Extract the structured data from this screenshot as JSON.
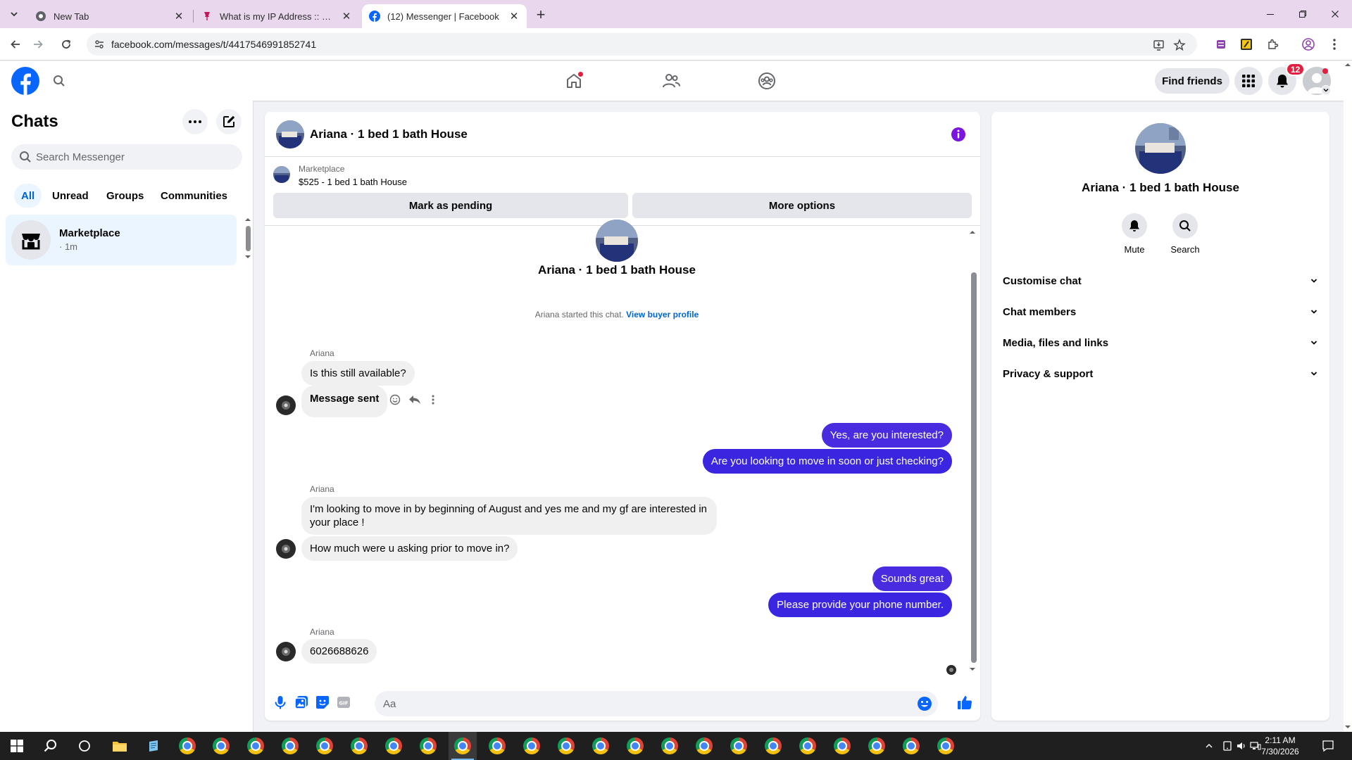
{
  "browser": {
    "tabs": [
      {
        "title": "New Tab",
        "active": false
      },
      {
        "title": "What is my IP Address :: WebBr",
        "active": false
      },
      {
        "title": "(12) Messenger | Facebook",
        "active": true
      }
    ],
    "url": "facebook.com/messages/t/4417546991852741"
  },
  "header": {
    "find_friends": "Find friends",
    "notifications_count": "12",
    "brand_color": "#0866ff"
  },
  "sidebar": {
    "title": "Chats",
    "search_placeholder": "Search Messenger",
    "filters": [
      "All",
      "Unread",
      "Groups",
      "Communities"
    ],
    "chats": [
      {
        "name": "Marketplace",
        "time": "· 1m"
      }
    ]
  },
  "conversation": {
    "title": "Ariana · 1 bed 1 bath House",
    "marketplace": {
      "label": "Marketplace",
      "listing": "$525 - 1 bed 1 bath House",
      "mark_pending": "Mark as pending",
      "more_options": "More options"
    },
    "intro_name": "Ariana · 1 bed 1 bath House",
    "started_text": "Ariana started this chat.",
    "view_profile": "View buyer profile",
    "messages": {
      "g1_sender": "Ariana",
      "m1": "Is this still available?",
      "m2": "Message sent",
      "m3": "Yes, are you interested?",
      "m4": "Are you looking to move in soon or just checking?",
      "g2_sender": "Ariana",
      "m5": "I'm looking to move in by beginning of August and yes me and my gf are interested in your place !",
      "m6": "How much were u asking prior to move in?",
      "m7": "Sounds great",
      "m8": "Please provide your phone number.",
      "g3_sender": "Ariana",
      "m9": "6026688626"
    },
    "composer_placeholder": "Aa",
    "outgoing_color": "#3a26e0"
  },
  "details": {
    "name": "Ariana · 1 bed 1 bath House",
    "mute": "Mute",
    "search": "Search",
    "sections": [
      "Customise chat",
      "Chat members",
      "Media, files and links",
      "Privacy & support"
    ]
  },
  "taskbar": {
    "time": "2:11 AM",
    "date": "7/30/2026"
  }
}
